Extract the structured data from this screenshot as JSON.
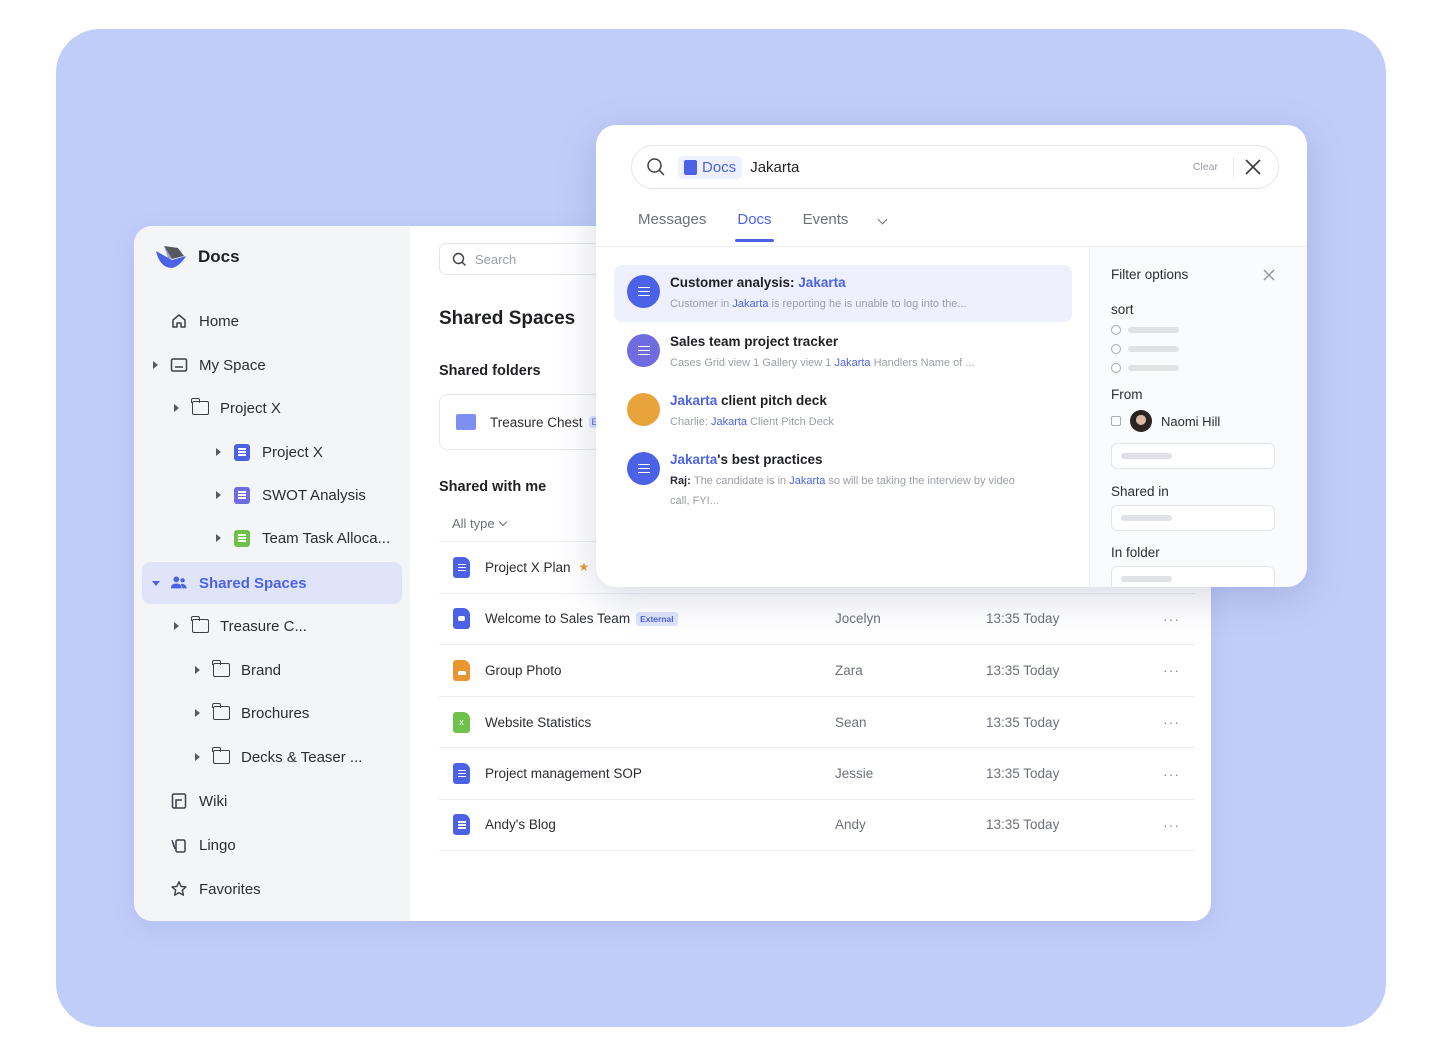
{
  "app": {
    "title": "Docs"
  },
  "sidebar": {
    "items": [
      {
        "label": "Home",
        "icon": "home-icon"
      },
      {
        "label": "My Space",
        "icon": "my-space-icon"
      },
      {
        "label": "Project X",
        "icon": "folder-icon"
      },
      {
        "label": "Project X",
        "icon": "doc-icon"
      },
      {
        "label": "SWOT Analysis",
        "icon": "list-doc-icon"
      },
      {
        "label": "Team Task Alloca...",
        "icon": "sheet-icon"
      },
      {
        "label": "Shared Spaces",
        "icon": "shared-spaces-icon"
      },
      {
        "label": "Treasure C...",
        "icon": "folder-icon"
      },
      {
        "label": "Brand",
        "icon": "folder-icon"
      },
      {
        "label": "Brochures",
        "icon": "folder-icon"
      },
      {
        "label": "Decks & Teaser ...",
        "icon": "folder-icon"
      },
      {
        "label": "Wiki",
        "icon": "wiki-icon"
      },
      {
        "label": "Lingo",
        "icon": "lingo-icon"
      },
      {
        "label": "Favorites",
        "icon": "star-icon"
      }
    ]
  },
  "main": {
    "search_placeholder": "Search",
    "page_title": "Shared Spaces",
    "shared_folders_heading": "Shared folders",
    "shared_folders": [
      {
        "name": "Treasure Chest",
        "tag": "E"
      }
    ],
    "shared_with_me_heading": "Shared with me",
    "type_filter": "All type",
    "files": [
      {
        "name": "Project X Plan",
        "badge": "",
        "starred": true,
        "owner": "",
        "time": "",
        "icon": "doc",
        "color": "#4c62e6"
      },
      {
        "name": "Welcome to Sales Team",
        "badge": "External",
        "starred": false,
        "owner": "Jocelyn",
        "time": "13:35 Today",
        "icon": "slides",
        "color": "#4c62e6"
      },
      {
        "name": "Group Photo",
        "badge": "",
        "starred": false,
        "owner": "Zara",
        "time": "13:35 Today",
        "icon": "image",
        "color": "#e8962f"
      },
      {
        "name": "Website Statistics",
        "badge": "",
        "starred": false,
        "owner": "Sean",
        "time": "13:35 Today",
        "icon": "sheet",
        "color": "#6cc24a"
      },
      {
        "name": "Project management SOP",
        "badge": "",
        "starred": false,
        "owner": "Jessie",
        "time": "13:35 Today",
        "icon": "doc",
        "color": "#4c62e6"
      },
      {
        "name": "Andy's Blog",
        "badge": "",
        "starred": false,
        "owner": "Andy",
        "time": "13:35 Today",
        "icon": "doc",
        "color": "#4c62e6"
      }
    ],
    "more_label": "···"
  },
  "popup": {
    "scope_chip": "Docs",
    "query": "Jakarta",
    "clear_label": "Clear",
    "tabs": [
      {
        "label": "Messages",
        "active": false
      },
      {
        "label": "Docs",
        "active": true
      },
      {
        "label": "Events",
        "active": false
      }
    ],
    "results": [
      {
        "title_pre": "Customer analysis: ",
        "title_hl": "Jakarta",
        "title_post": "",
        "snippet_lead": "",
        "snippet_pre": "Customer in ",
        "snippet_hl": "Jakarta",
        "snippet_post": " is reporting he is unable to log into the...",
        "icon_color": "#4c62e6",
        "selected": true
      },
      {
        "title_pre": "Sales team project tracker",
        "title_hl": "",
        "title_post": "",
        "snippet_lead": "",
        "snippet_pre": "Cases Grid view 1 Gallery view 1 ",
        "snippet_hl": "Jakarta",
        "snippet_post": " Handlers Name of ...",
        "icon_color": "#6f6ce0",
        "selected": false
      },
      {
        "title_pre": "",
        "title_hl": "Jakarta",
        "title_post": " client pitch deck",
        "snippet_lead": "Charlie: ",
        "snippet_pre": "",
        "snippet_hl": "Jakarta",
        "snippet_post": " Client Pitch Deck",
        "icon_color": "#e8a33a",
        "selected": false
      },
      {
        "title_pre": "",
        "title_hl": "Jakarta",
        "title_post": "'s best practices",
        "snippet_lead": "Raj: ",
        "snippet_pre": "The candidate is in ",
        "snippet_hl": "Jakarta",
        "snippet_post": " so will be taking the interview by video call, FYI...",
        "icon_color": "#4c62e6",
        "selected": false
      }
    ],
    "filter": {
      "title": "Filter options",
      "sort_label": "sort",
      "from_label": "From",
      "from_person": "Naomi Hill",
      "shared_in_label": "Shared in",
      "in_folder_label": "In folder"
    }
  },
  "colors": {
    "accent": "#4c62e6",
    "backdrop": "#c1cdf9",
    "sidebar_bg": "#f4f5f7",
    "active_bg": "#dfe4fb"
  }
}
